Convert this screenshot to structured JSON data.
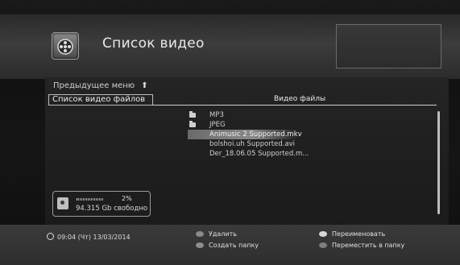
{
  "header": {
    "title": "Список видео"
  },
  "menu": {
    "previous": "Предыдущее меню",
    "current": "Список видео файлов",
    "column_header": "Видео файлы"
  },
  "files": [
    {
      "name": "MP3",
      "type": "folder"
    },
    {
      "name": "JPEG",
      "type": "folder"
    },
    {
      "name": "Animusic 2 Supported.mkv",
      "type": "file",
      "selected": true
    },
    {
      "name": "bolshoi.uh Supported.avi",
      "type": "file"
    },
    {
      "name": "Der_18.06.05 Supported.m...",
      "type": "file"
    }
  ],
  "storage": {
    "used_percent_label": "2%",
    "used_fraction": 0.02,
    "free": "94.315 Gb свободно"
  },
  "footer": {
    "clock": "09:04 (Чт) 13/03/2014",
    "actions": [
      {
        "key": "red",
        "label": "Удалить"
      },
      {
        "key": "green",
        "label": "Создать папку"
      },
      {
        "key": "yellow",
        "label": "Переименовать"
      },
      {
        "key": "blue",
        "label": "Переместить в папку"
      }
    ]
  },
  "icons": {
    "header": "film-reel-icon",
    "folder": "folder-icon",
    "storage": "hdd-icon",
    "clock": "clock-icon",
    "up_arrow": "up-arrow-icon"
  }
}
